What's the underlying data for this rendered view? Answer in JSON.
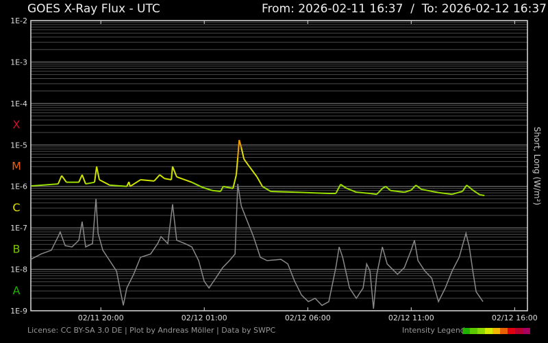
{
  "header": {
    "title": "GOES X-Ray Flux - UTC",
    "range": "From: 2026-02-11 16:37  /  To: 2026-02-12 16:37"
  },
  "footer": {
    "license": "License: CC BY-SA 3.0 DE | Plot by Andreas Möller | Data by SWPC",
    "legend_label": "Intensity Legend",
    "legend_colors": [
      "#22b000",
      "#5cc800",
      "#8ed800",
      "#d4e800",
      "#f0b800",
      "#e86000",
      "#e00010",
      "#b8002c",
      "#a80060"
    ]
  },
  "chart_data": {
    "type": "line",
    "title": "GOES X-Ray Flux - UTC",
    "ylabel": "Short, Long (W/m²)",
    "yscale": "log",
    "ylim_log10": [
      -9,
      -2
    ],
    "y_ticks": [
      "1E-9",
      "1E-8",
      "1E-7",
      "1E-6",
      "1E-5",
      "1E-4",
      "1E-3",
      "1E-2"
    ],
    "x_unit": "hours since 2026-02-11 16:37 UTC",
    "xlim": [
      0,
      24
    ],
    "x_ticks": [
      {
        "h": 3.383,
        "label": "02/11 20:00"
      },
      {
        "h": 8.383,
        "label": "02/12 01:00"
      },
      {
        "h": 13.383,
        "label": "02/12 06:00"
      },
      {
        "h": 18.383,
        "label": "02/12 11:00"
      },
      {
        "h": 23.383,
        "label": "02/12 16:00"
      }
    ],
    "flare_classes": [
      {
        "label": "X",
        "color": "#d0102a"
      },
      {
        "label": "M",
        "color": "#e86010"
      },
      {
        "label": "C",
        "color": "#dde000"
      },
      {
        "label": "B",
        "color": "#7cc400"
      },
      {
        "label": "A",
        "color": "#20b000"
      }
    ],
    "grid": true,
    "series": [
      {
        "name": "Long",
        "color": "by-intensity",
        "points": [
          [
            0,
            -5.99
          ],
          [
            1.32,
            -5.94
          ],
          [
            1.49,
            -5.74
          ],
          [
            1.72,
            -5.9
          ],
          [
            2.32,
            -5.9
          ],
          [
            2.48,
            -5.72
          ],
          [
            2.65,
            -5.94
          ],
          [
            3.08,
            -5.9
          ],
          [
            3.18,
            -5.52
          ],
          [
            3.31,
            -5.84
          ],
          [
            3.81,
            -5.97
          ],
          [
            4.64,
            -6.0
          ],
          [
            4.74,
            -5.89
          ],
          [
            4.8,
            -6.0
          ],
          [
            5.3,
            -5.84
          ],
          [
            5.96,
            -5.87
          ],
          [
            6.23,
            -5.72
          ],
          [
            6.46,
            -5.81
          ],
          [
            6.79,
            -5.84
          ],
          [
            6.85,
            -5.52
          ],
          [
            7.05,
            -5.77
          ],
          [
            7.78,
            -5.9
          ],
          [
            8.28,
            -6.02
          ],
          [
            8.77,
            -6.1
          ],
          [
            9.17,
            -6.12
          ],
          [
            9.3,
            -6.0
          ],
          [
            9.77,
            -6.05
          ],
          [
            9.93,
            -5.72
          ],
          [
            10.0,
            -5.31
          ],
          [
            10.07,
            -4.88
          ],
          [
            10.17,
            -5.06
          ],
          [
            10.3,
            -5.34
          ],
          [
            10.5,
            -5.48
          ],
          [
            10.93,
            -5.77
          ],
          [
            11.19,
            -6.0
          ],
          [
            11.59,
            -6.12
          ],
          [
            12.75,
            -6.14
          ],
          [
            14.4,
            -6.17
          ],
          [
            14.74,
            -6.17
          ],
          [
            14.97,
            -5.95
          ],
          [
            15.23,
            -6.04
          ],
          [
            15.73,
            -6.14
          ],
          [
            16.39,
            -6.17
          ],
          [
            16.72,
            -6.19
          ],
          [
            16.99,
            -6.05
          ],
          [
            17.15,
            -6.0
          ],
          [
            17.38,
            -6.1
          ],
          [
            18.05,
            -6.14
          ],
          [
            18.38,
            -6.09
          ],
          [
            18.61,
            -5.97
          ],
          [
            18.87,
            -6.07
          ],
          [
            19.7,
            -6.15
          ],
          [
            20.36,
            -6.19
          ],
          [
            20.86,
            -6.12
          ],
          [
            21.06,
            -5.97
          ],
          [
            21.36,
            -6.09
          ],
          [
            21.69,
            -6.2
          ],
          [
            21.92,
            -6.22
          ]
        ]
      },
      {
        "name": "Short",
        "color": "#8a8a8a",
        "points": [
          [
            0,
            -7.76
          ],
          [
            0.5,
            -7.63
          ],
          [
            0.99,
            -7.54
          ],
          [
            1.32,
            -7.21
          ],
          [
            1.42,
            -7.1
          ],
          [
            1.66,
            -7.43
          ],
          [
            1.99,
            -7.46
          ],
          [
            2.32,
            -7.3
          ],
          [
            2.48,
            -6.85
          ],
          [
            2.65,
            -7.46
          ],
          [
            2.98,
            -7.38
          ],
          [
            3.15,
            -6.3
          ],
          [
            3.25,
            -7.13
          ],
          [
            3.48,
            -7.54
          ],
          [
            3.81,
            -7.79
          ],
          [
            4.14,
            -8.04
          ],
          [
            4.3,
            -8.45
          ],
          [
            4.47,
            -8.87
          ],
          [
            4.64,
            -8.45
          ],
          [
            4.97,
            -8.12
          ],
          [
            5.3,
            -7.71
          ],
          [
            5.79,
            -7.63
          ],
          [
            6.13,
            -7.38
          ],
          [
            6.29,
            -7.21
          ],
          [
            6.62,
            -7.38
          ],
          [
            6.85,
            -6.43
          ],
          [
            7.05,
            -7.3
          ],
          [
            7.45,
            -7.38
          ],
          [
            7.78,
            -7.46
          ],
          [
            8.11,
            -7.79
          ],
          [
            8.38,
            -8.29
          ],
          [
            8.61,
            -8.45
          ],
          [
            8.94,
            -8.21
          ],
          [
            9.27,
            -7.96
          ],
          [
            9.6,
            -7.79
          ],
          [
            9.87,
            -7.63
          ],
          [
            10.0,
            -5.94
          ],
          [
            10.17,
            -6.47
          ],
          [
            10.43,
            -6.8
          ],
          [
            10.76,
            -7.21
          ],
          [
            11.09,
            -7.71
          ],
          [
            11.42,
            -7.79
          ],
          [
            12.09,
            -7.76
          ],
          [
            12.42,
            -7.87
          ],
          [
            12.75,
            -8.29
          ],
          [
            13.08,
            -8.62
          ],
          [
            13.41,
            -8.78
          ],
          [
            13.74,
            -8.7
          ],
          [
            14.07,
            -8.87
          ],
          [
            14.4,
            -8.78
          ],
          [
            14.74,
            -7.96
          ],
          [
            14.9,
            -7.46
          ],
          [
            15.07,
            -7.71
          ],
          [
            15.4,
            -8.45
          ],
          [
            15.73,
            -8.7
          ],
          [
            16.06,
            -8.45
          ],
          [
            16.23,
            -7.87
          ],
          [
            16.39,
            -8.04
          ],
          [
            16.56,
            -8.95
          ],
          [
            16.72,
            -8.12
          ],
          [
            16.99,
            -7.46
          ],
          [
            17.22,
            -7.87
          ],
          [
            17.72,
            -8.12
          ],
          [
            18.05,
            -7.96
          ],
          [
            18.38,
            -7.54
          ],
          [
            18.54,
            -7.3
          ],
          [
            18.71,
            -7.79
          ],
          [
            19.04,
            -8.04
          ],
          [
            19.37,
            -8.21
          ],
          [
            19.7,
            -8.78
          ],
          [
            20.03,
            -8.45
          ],
          [
            20.36,
            -8.04
          ],
          [
            20.7,
            -7.71
          ],
          [
            21.03,
            -7.13
          ],
          [
            21.19,
            -7.46
          ],
          [
            21.36,
            -8.04
          ],
          [
            21.52,
            -8.54
          ],
          [
            21.85,
            -8.78
          ]
        ]
      }
    ]
  }
}
